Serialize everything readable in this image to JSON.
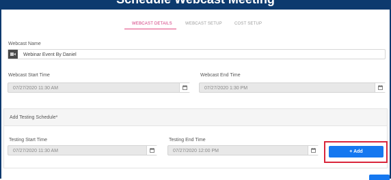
{
  "header": {
    "title": "Schedule Webcast Meeting"
  },
  "tabs": [
    {
      "label": "WEBCAST DETAILS",
      "active": true
    },
    {
      "label": "WEBCAST SETUP",
      "active": false
    },
    {
      "label": "COST SETUP",
      "active": false
    }
  ],
  "webcast_name": {
    "label": "Webcast Name",
    "value": "Webinar Event By Daniel"
  },
  "webcast_start": {
    "label": "Webcast Start Time",
    "value": "07/27/2020 11:30 AM"
  },
  "webcast_end": {
    "label": "Webcast End Time",
    "value": "07/27/2020 1:30 PM"
  },
  "testing": {
    "title": "Add Testing Schedule*",
    "start": {
      "label": "Testing Start Time",
      "value": "07/27/2020 11:30 AM"
    },
    "end": {
      "label": "Testing End Time",
      "value": "07/27/2020 12:00 PM"
    },
    "add_label": "+ Add"
  },
  "colors": {
    "header_bg": "#0d3a6e",
    "active_tab": "#d0357a",
    "primary_button": "#1578f0",
    "highlight_border": "#d9253a"
  },
  "icons": [
    "video-icon",
    "calendar-icon"
  ]
}
